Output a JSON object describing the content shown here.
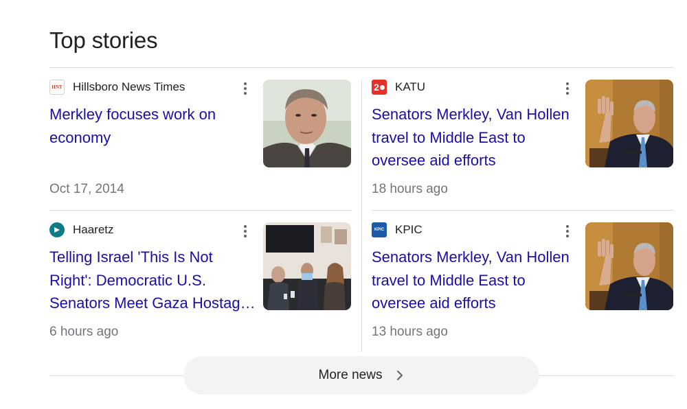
{
  "section": {
    "title": "Top stories"
  },
  "stories": [
    {
      "source": "Hillsboro News Times",
      "favicon_text": "HNT",
      "headline_lines": [
        "Merkley focuses work on",
        "economy"
      ],
      "time": "Oct 17, 2014"
    },
    {
      "source": "KATU",
      "favicon_text": "2",
      "headline_lines": [
        "Senators Merkley, Van Hollen",
        "travel to Middle East to",
        "oversee aid efforts"
      ],
      "time": "18 hours ago"
    },
    {
      "source": "Haaretz",
      "favicon_text": "",
      "headline_lines": [
        "Telling Israel 'This Is Not",
        "Right': Democratic U.S.",
        "Senators Meet Gaza Hostag…"
      ],
      "time": "6 hours ago"
    },
    {
      "source": "KPIC",
      "favicon_text": "KPIC",
      "headline_lines": [
        "Senators Merkley, Van Hollen",
        "travel to Middle East to",
        "oversee aid efforts"
      ],
      "time": "13 hours ago"
    }
  ],
  "more_news": {
    "label": "More news"
  },
  "icons": {
    "kebab": "more-vert-icon",
    "chevron": "chevron-right-icon"
  },
  "colors": {
    "headline": "#1a0dab",
    "meta": "#70757a",
    "divider": "#dadce0",
    "button_bg": "#f1f3f4"
  }
}
